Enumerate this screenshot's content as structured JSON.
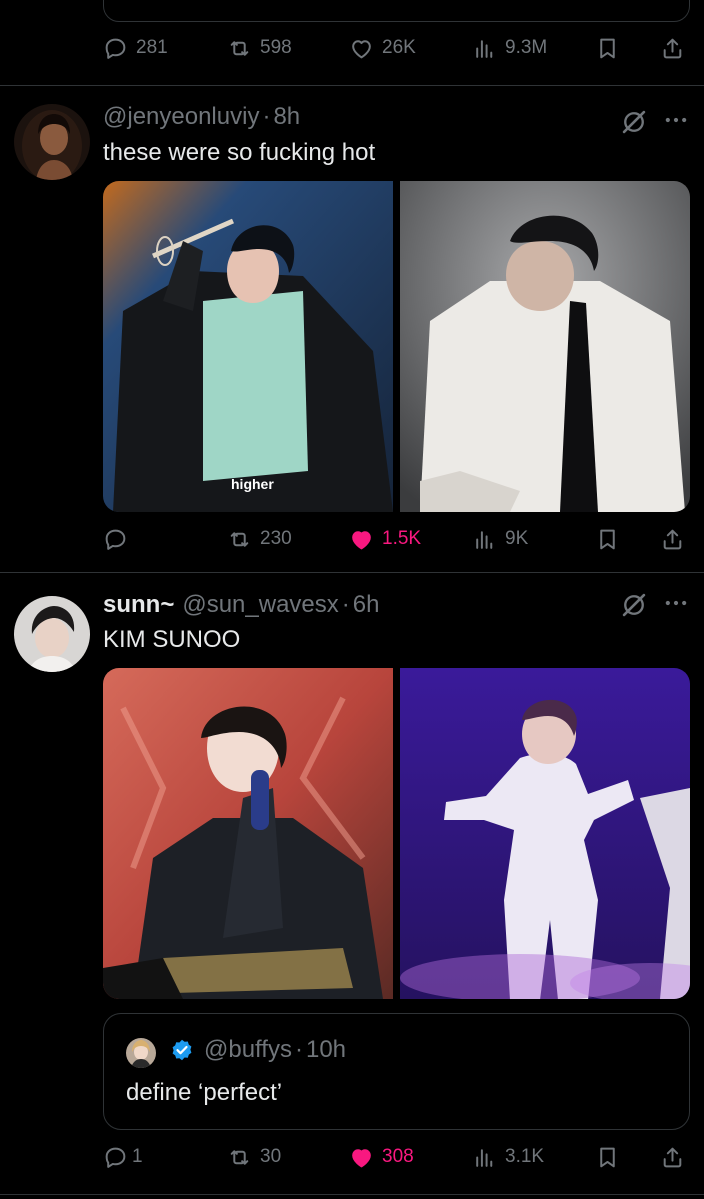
{
  "previous_tweet": {
    "stats": {
      "replies": "281",
      "reposts": "598",
      "likes": "26K",
      "views": "9.3M"
    }
  },
  "tweets": [
    {
      "display_name": "",
      "handle": "@jenyeonluviy",
      "time": "8h",
      "text": "these were so fucking hot",
      "media_captions": [
        "higher"
      ],
      "stats": {
        "replies": "",
        "reposts": "230",
        "likes": "1.5K",
        "views": "9K"
      },
      "liked": true
    },
    {
      "display_name": "sunn~",
      "handle": "@sun_wavesx",
      "time": "6h",
      "text": "KIM SUNOO",
      "stats": {
        "replies": "1",
        "reposts": "30",
        "likes": "308",
        "views": "3.1K"
      },
      "liked": true,
      "quote": {
        "handle": "@buffys",
        "time": "10h",
        "verified": true,
        "text": "define ‘perfect’"
      }
    }
  ],
  "separator": "·",
  "icons": [
    "reply-icon",
    "repost-icon",
    "like-icon",
    "views-icon",
    "bookmark-icon",
    "share-icon",
    "grok-icon",
    "more-icon",
    "verified-badge-icon"
  ],
  "colors": {
    "background": "#000000",
    "text": "#e7e9ea",
    "muted": "#71767b",
    "like": "#f91880",
    "border": "#2f3336",
    "verified": "#1d9bf0"
  }
}
